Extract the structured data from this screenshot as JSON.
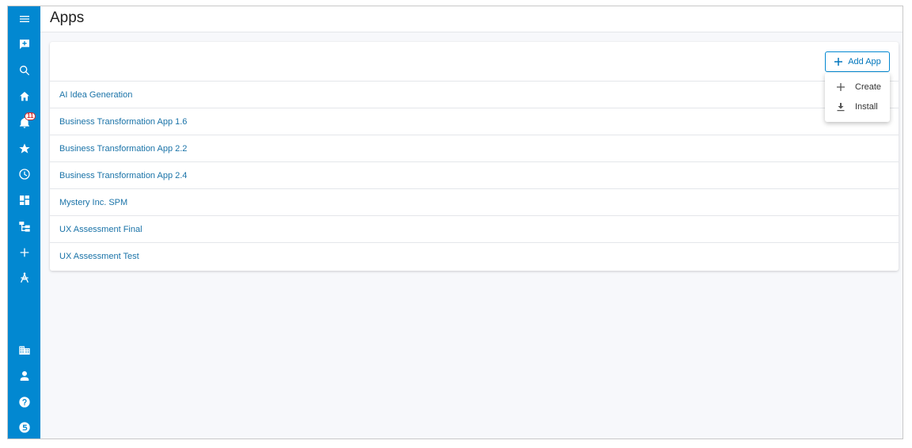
{
  "header": {
    "title": "Apps"
  },
  "sidebar": {
    "notification_count": "11",
    "items": [
      {
        "icon": "menu-icon"
      },
      {
        "icon": "add-comment-icon"
      },
      {
        "icon": "search-icon"
      },
      {
        "icon": "home-icon"
      },
      {
        "icon": "bell-icon"
      },
      {
        "icon": "star-icon"
      },
      {
        "icon": "clock-icon"
      },
      {
        "icon": "dashboard-icon"
      },
      {
        "icon": "hierarchy-icon"
      },
      {
        "icon": "plus-icon"
      },
      {
        "icon": "compass-icon"
      },
      {
        "icon": "building-icon"
      },
      {
        "icon": "person-icon"
      },
      {
        "icon": "help-icon"
      },
      {
        "icon": "logo-icon"
      }
    ]
  },
  "toolbar": {
    "add_app_label": "Add App"
  },
  "dropdown": {
    "create_label": "Create",
    "install_label": "Install"
  },
  "apps": [
    "AI Idea Generation",
    "Business Transformation App 1.6",
    "Business Transformation App 2.2",
    "Business Transformation App 2.4",
    "Mystery Inc. SPM",
    "UX Assessment Final",
    "UX Assessment Test"
  ],
  "colors": {
    "accent": "#0288d1",
    "link": "#1a73a8",
    "background": "#f7f8fb"
  }
}
